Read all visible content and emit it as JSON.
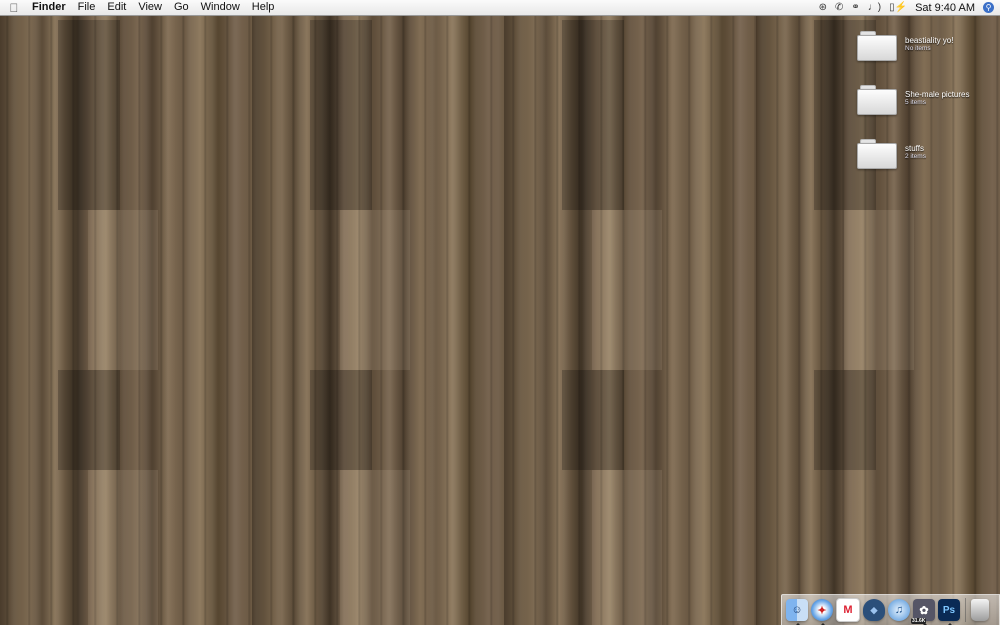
{
  "menubar": {
    "apple_icon": "apple-icon",
    "app_name": "Finder",
    "menus": [
      "File",
      "Edit",
      "View",
      "Go",
      "Window",
      "Help"
    ],
    "extras": {
      "bluetooth_icon": "bluetooth-icon",
      "phone_icon": "phone-icon",
      "wifi_icon": "wifi-icon",
      "volume_icon": "volume-icon",
      "battery_icon": "battery-icon",
      "clock": "Sat 9:40 AM",
      "spotlight_icon": "spotlight-icon"
    }
  },
  "desktop": {
    "icons": [
      {
        "name": "beastiality yo!",
        "info": "No items",
        "icon": "folder-icon"
      },
      {
        "name": "She-male pictures",
        "info": "5 items",
        "icon": "folder-icon"
      },
      {
        "name": "stuffs",
        "info": "2 items",
        "icon": "folder-icon"
      }
    ]
  },
  "dock": {
    "items": [
      {
        "name": "finder",
        "icon": "finder-icon",
        "glyph": "☺",
        "running": true
      },
      {
        "name": "safari",
        "icon": "safari-icon",
        "glyph": "✦",
        "running": true
      },
      {
        "name": "gmail",
        "icon": "gmail-icon",
        "glyph": "M",
        "running": false
      },
      {
        "name": "app",
        "icon": "app-icon",
        "glyph": "◆",
        "running": false
      },
      {
        "name": "itunes",
        "icon": "itunes-icon",
        "glyph": "♫",
        "running": false
      },
      {
        "name": "app2",
        "icon": "app2-icon",
        "glyph": "✿",
        "running": true
      },
      {
        "name": "photoshop",
        "icon": "photoshop-icon",
        "glyph": "Ps",
        "running": true
      }
    ],
    "badge": "31.6K",
    "trash_icon": "trash-icon"
  }
}
